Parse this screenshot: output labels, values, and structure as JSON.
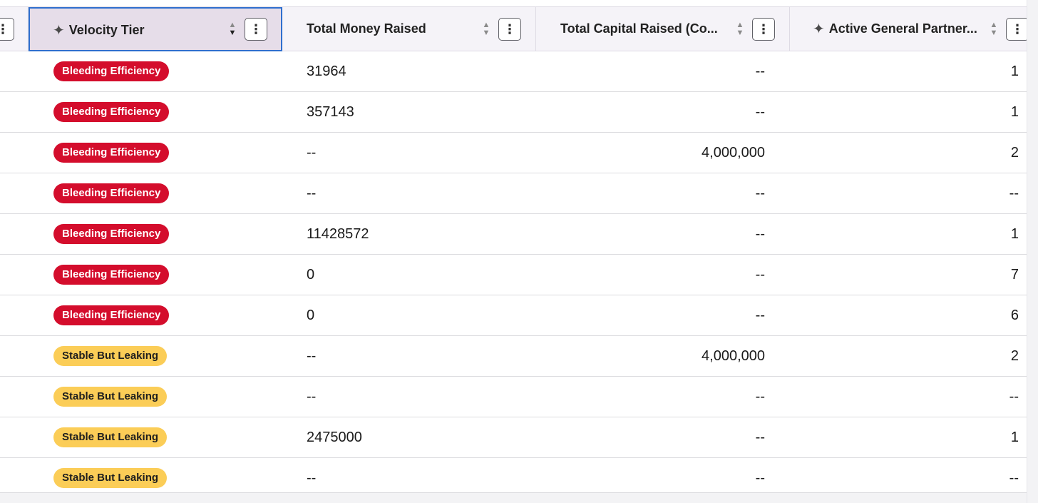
{
  "header": {
    "columns": [
      {
        "title": "Velocity Tier",
        "ai": true
      },
      {
        "title": "Total Money Raised",
        "ai": false
      },
      {
        "title": "Total Capital Raised (Co...",
        "ai": false
      },
      {
        "title": "Active General Partner...",
        "ai": true
      }
    ],
    "menu_glyph": "⋮",
    "sparkle_glyph": "✦",
    "sort_up": "▲",
    "sort_down": "▼"
  },
  "rows": [
    {
      "tier": "Bleeding Efficiency",
      "tier_color": "red",
      "money": "31964",
      "capital": "--",
      "partners": "1"
    },
    {
      "tier": "Bleeding Efficiency",
      "tier_color": "red",
      "money": "357143",
      "capital": "--",
      "partners": "1"
    },
    {
      "tier": "Bleeding Efficiency",
      "tier_color": "red",
      "money": "--",
      "capital": "4,000,000",
      "partners": "2"
    },
    {
      "tier": "Bleeding Efficiency",
      "tier_color": "red",
      "money": "--",
      "capital": "--",
      "partners": "--"
    },
    {
      "tier": "Bleeding Efficiency",
      "tier_color": "red",
      "money": "11428572",
      "capital": "--",
      "partners": "1"
    },
    {
      "tier": "Bleeding Efficiency",
      "tier_color": "red",
      "money": "0",
      "capital": "--",
      "partners": "7"
    },
    {
      "tier": "Bleeding Efficiency",
      "tier_color": "red",
      "money": "0",
      "capital": "--",
      "partners": "6"
    },
    {
      "tier": "Stable But Leaking",
      "tier_color": "yellow",
      "money": "--",
      "capital": "4,000,000",
      "partners": "2"
    },
    {
      "tier": "Stable But Leaking",
      "tier_color": "yellow",
      "money": "--",
      "capital": "--",
      "partners": "--"
    },
    {
      "tier": "Stable But Leaking",
      "tier_color": "yellow",
      "money": "2475000",
      "capital": "--",
      "partners": "1"
    },
    {
      "tier": "Stable But Leaking",
      "tier_color": "yellow",
      "money": "--",
      "capital": "--",
      "partners": "--"
    }
  ],
  "colors": {
    "red_badge": "#d40d2c",
    "yellow_badge": "#fbcd57",
    "active_header_bg": "#e6dde9",
    "active_header_border": "#2f6fce",
    "header_bg": "#f5f3f8"
  }
}
